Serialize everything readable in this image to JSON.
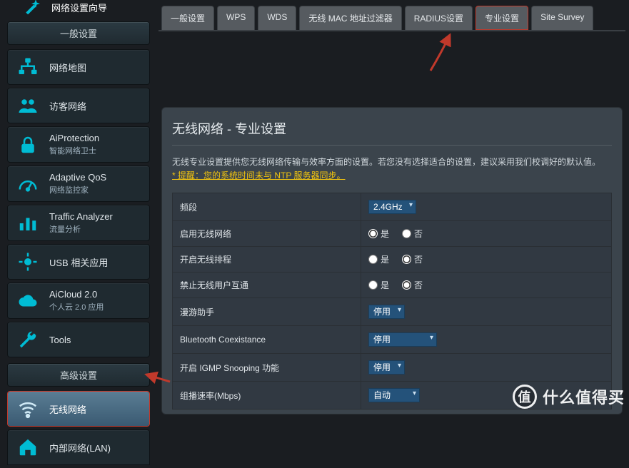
{
  "colors": {
    "accent": "#00bcd4",
    "highlight": "#c1392b",
    "warn": "#f1c40f"
  },
  "sidebar": {
    "wizard": {
      "label": "网络设置向导"
    },
    "section_general": "一般设置",
    "items": [
      {
        "label": "网络地图",
        "sub": "",
        "icon": "network-map-icon"
      },
      {
        "label": "访客网络",
        "sub": "",
        "icon": "guest-network-icon"
      },
      {
        "label": "AiProtection",
        "sub": "智能网络卫士",
        "icon": "lock-icon"
      },
      {
        "label": "Adaptive QoS",
        "sub": "网络监控家",
        "icon": "gauge-icon"
      },
      {
        "label": "Traffic Analyzer",
        "sub": "流量分析",
        "icon": "bars-icon"
      },
      {
        "label": "USB 相关应用",
        "sub": "",
        "icon": "plug-icon"
      },
      {
        "label": "AiCloud 2.0",
        "sub": "个人云 2.0 应用",
        "icon": "cloud-icon"
      },
      {
        "label": "Tools",
        "sub": "",
        "icon": "wrench-icon"
      }
    ],
    "section_advanced": "高级设置",
    "adv_items": [
      {
        "label": "无线网络",
        "sub": "",
        "icon": "wifi-icon",
        "active": true
      },
      {
        "label": "内部网络(LAN)",
        "sub": "",
        "icon": "home-icon"
      }
    ]
  },
  "tabs": [
    {
      "label": "一般设置"
    },
    {
      "label": "WPS"
    },
    {
      "label": "WDS"
    },
    {
      "label": "无线 MAC 地址过滤器"
    },
    {
      "label": "RADIUS设置"
    },
    {
      "label": "专业设置",
      "highlight": true
    },
    {
      "label": "Site Survey"
    }
  ],
  "panel": {
    "title": "无线网络 - 专业设置",
    "desc": "无线专业设置提供您无线网络传输与效率方面的设置。若您没有选择适合的设置，建议采用我们校调好的默认值。",
    "warn": "* 提醒：您的系统时间未与 NTP 服务器同步。"
  },
  "form": {
    "yes": "是",
    "no": "否",
    "rows": [
      {
        "label": "频段",
        "type": "select",
        "value": "2.4GHz"
      },
      {
        "label": "启用无线网络",
        "type": "radio",
        "value": "yes"
      },
      {
        "label": "开启无线排程",
        "type": "radio",
        "value": "no"
      },
      {
        "label": "禁止无线用户互通",
        "type": "radio",
        "value": "no"
      },
      {
        "label": "漫游助手",
        "type": "select",
        "value": "停用"
      },
      {
        "label": "Bluetooth Coexistance",
        "type": "select",
        "value": "停用",
        "wide": true
      },
      {
        "label": "开启 IGMP Snooping 功能",
        "type": "select",
        "value": "停用"
      },
      {
        "label": "组播速率(Mbps)",
        "type": "select",
        "value": "自动",
        "wide": true
      }
    ]
  },
  "watermark": {
    "badge": "值",
    "text": "什么值得买"
  }
}
